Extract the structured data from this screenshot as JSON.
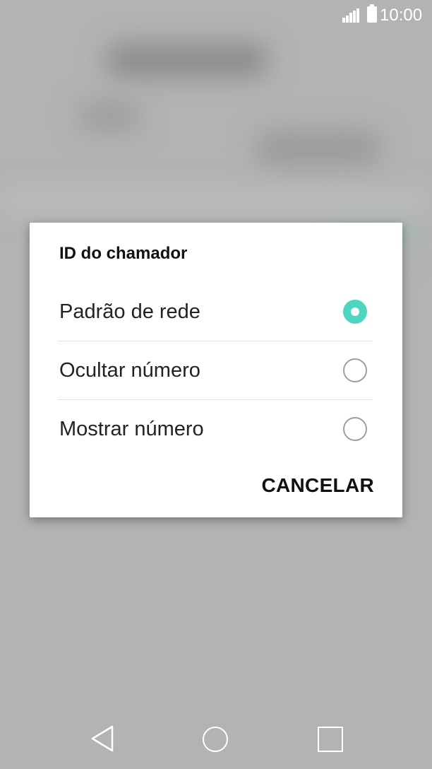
{
  "status_bar": {
    "time": "10:00",
    "signal_icon": "signal-icon",
    "battery_icon": "battery-icon"
  },
  "dialog": {
    "title": "ID do chamador",
    "options": [
      {
        "label": "Padrão de rede",
        "selected": true
      },
      {
        "label": "Ocultar número",
        "selected": false
      },
      {
        "label": "Mostrar número",
        "selected": false
      }
    ],
    "cancel_label": "CANCELAR",
    "accent_color": "#4fd6c0"
  },
  "nav_bar": {
    "back_icon": "back-triangle-icon",
    "home_icon": "home-circle-icon",
    "recent_icon": "recent-apps-square-icon"
  }
}
